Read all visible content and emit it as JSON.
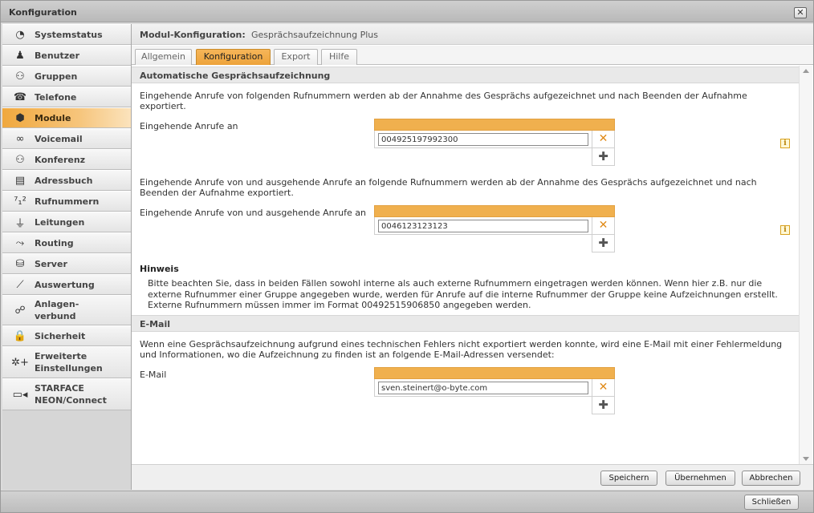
{
  "window": {
    "title": "Konfiguration",
    "close_icon": "close-icon"
  },
  "sidebar": {
    "items": [
      {
        "label": "Systemstatus",
        "icon": "◔",
        "active": false
      },
      {
        "label": "Benutzer",
        "icon": "♟",
        "active": false
      },
      {
        "label": "Gruppen",
        "icon": "⚇",
        "active": false
      },
      {
        "label": "Telefone",
        "icon": "☎",
        "active": false
      },
      {
        "label": "Module",
        "icon": "⬢",
        "active": true
      },
      {
        "label": "Voicemail",
        "icon": "∞",
        "active": false
      },
      {
        "label": "Konferenz",
        "icon": "⚇",
        "active": false
      },
      {
        "label": "Adressbuch",
        "icon": "▤",
        "active": false
      },
      {
        "label": "Rufnummern",
        "icon": "⁷₁²",
        "active": false
      },
      {
        "label": "Leitungen",
        "icon": "⏚",
        "active": false
      },
      {
        "label": "Routing",
        "icon": "⤳",
        "active": false
      },
      {
        "label": "Server",
        "icon": "⛁",
        "active": false
      },
      {
        "label": "Auswertung",
        "icon": "⟋",
        "active": false
      },
      {
        "label": "Anlagen-\nverbund",
        "icon": "☍",
        "active": false
      },
      {
        "label": "Sicherheit",
        "icon": "🔒",
        "active": false
      },
      {
        "label": "Erweiterte\nEinstellungen",
        "icon": "✲+",
        "active": false
      },
      {
        "label": "STARFACE\nNEON/Connect",
        "icon": "▭◂",
        "active": false
      }
    ]
  },
  "module_header": {
    "label": "Modul-Konfiguration:",
    "value": "Gesprächsaufzeichnung Plus"
  },
  "tabs": [
    {
      "label": "Allgemein",
      "active": false
    },
    {
      "label": "Konfiguration",
      "active": true
    },
    {
      "label": "Export",
      "active": false
    },
    {
      "label": "Hilfe",
      "active": false
    }
  ],
  "section1": {
    "title": "Automatische Gesprächsaufzeichnung",
    "desc1": "Eingehende Anrufe von folgenden Rufnummern werden ab der Annahme des Gesprächs aufgezeichnet und nach Beenden der Aufnahme\nexportiert.",
    "field1_label": "Eingehende Anrufe an",
    "field1_value": "004925197992300",
    "desc2": "Eingehende Anrufe von und ausgehende Anrufe an folgende Rufnummern werden ab der Annahme des Gesprächs aufgezeichnet und nach\nBeenden der Aufnahme exportiert.",
    "field2_label": "Eingehende Anrufe von und ausgehende Anrufe an",
    "field2_value": "0046123123123",
    "hint_title": "Hinweis",
    "hint_text": "Bitte beachten Sie, dass in beiden Fällen sowohl interne als auch externe Rufnummern eingetragen werden können. Wenn hier z.B. nur die\nexterne Rufnummer einer Gruppe angegeben wurde, werden für Anrufe auf die interne Rufnummer der Gruppe keine Aufzeichnungen erstellt.\nExterne Rufnummern müssen immer im Format 00492515906850 angegeben werden."
  },
  "section2": {
    "title": "E-Mail",
    "desc": "Wenn eine Gesprächsaufzeichnung aufgrund eines technischen Fehlers nicht exportiert werden konnte, wird eine E-Mail mit einer Fehlermeldung\nund Informationen, wo die Aufzeichnung zu finden ist an folgende E-Mail-Adressen versendet:",
    "field_label": "E-Mail",
    "field_value": "sven.steinert@o-byte.com"
  },
  "icons": {
    "delete": "✕",
    "add": "✚",
    "info": "i"
  },
  "colors": {
    "accent": "#f0b04e",
    "active_nav": "#f0a83e"
  },
  "footer": {
    "save": "Speichern",
    "apply": "Übernehmen",
    "cancel": "Abbrechen"
  },
  "bottom": {
    "close": "Schließen"
  }
}
